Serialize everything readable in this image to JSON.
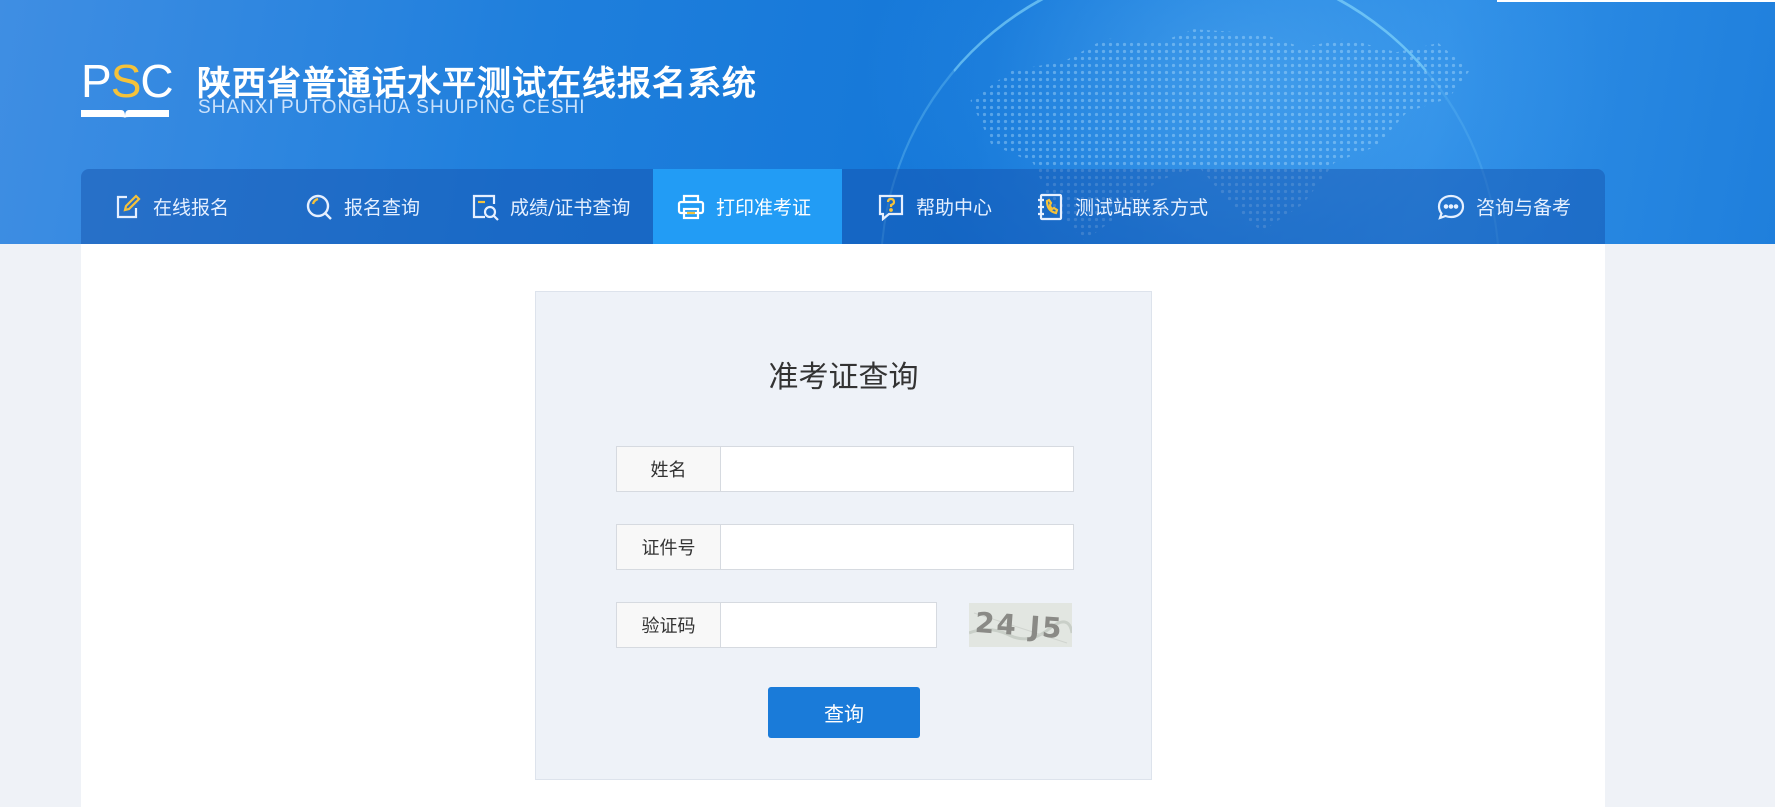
{
  "header": {
    "logo_text_p": "P",
    "logo_text_s": "S",
    "logo_text_c": "C",
    "title": "陕西省普通话水平测试在线报名系统",
    "subtitle": "SHANXI PUTONGHUA SHUIPING CESHI"
  },
  "nav": {
    "items": [
      {
        "label": "在线报名",
        "icon": "edit-icon"
      },
      {
        "label": "报名查询",
        "icon": "search-circle-icon"
      },
      {
        "label": "成绩/证书查询",
        "icon": "document-search-icon"
      },
      {
        "label": "打印准考证",
        "icon": "printer-icon",
        "active": true
      },
      {
        "label": "帮助中心",
        "icon": "help-icon"
      },
      {
        "label": "测试站联系方式",
        "icon": "phone-book-icon"
      },
      {
        "label": "咨询与备考",
        "icon": "chat-icon"
      }
    ]
  },
  "form": {
    "title": "准考证查询",
    "name_label": "姓名",
    "name_value": "",
    "id_label": "证件号",
    "id_value": "",
    "captcha_label": "验证码",
    "captcha_value": "",
    "captcha_text": "24 J5",
    "submit_label": "查询"
  },
  "colors": {
    "header_blue": "#1477d8",
    "nav_active": "#229cf5",
    "button_blue": "#1a7bd9",
    "logo_accent": "#f5c23a",
    "page_bg": "#eff2f7"
  }
}
